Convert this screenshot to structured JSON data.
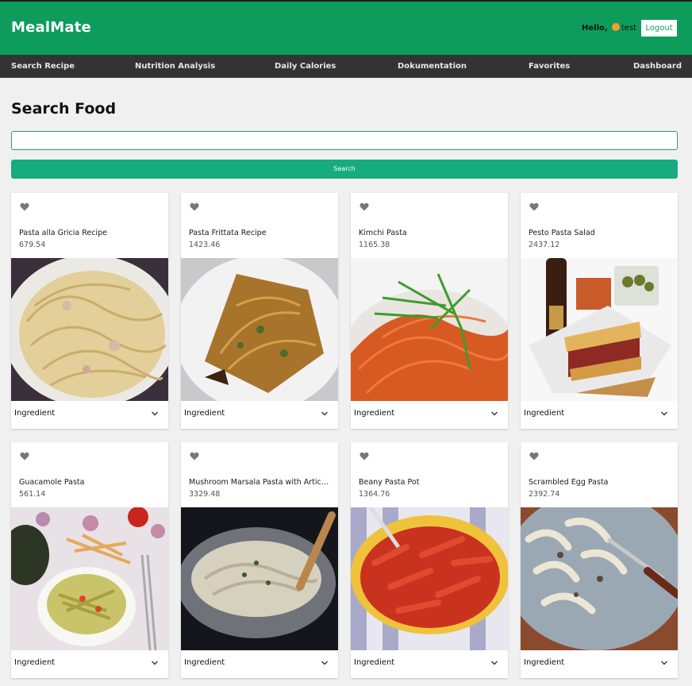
{
  "app": {
    "brand": "MealMate"
  },
  "header": {
    "greeting_prefix": "Hello,",
    "user": "test",
    "logout_label": "Logout"
  },
  "nav": {
    "items": [
      {
        "label": "Search Recipe"
      },
      {
        "label": "Nutrition Analysis"
      },
      {
        "label": "Daily Calories"
      },
      {
        "label": "Dokumentation"
      },
      {
        "label": "Favorites"
      },
      {
        "label": "Dashboard"
      }
    ]
  },
  "search": {
    "title": "Search Food",
    "value": "",
    "placeholder": "",
    "button_label": "Search"
  },
  "recipes": [
    {
      "title": "Pasta alla Gricia Recipe",
      "calories": "679.54",
      "expander_label": "Ingredient"
    },
    {
      "title": "Pasta Frittata Recipe",
      "calories": "1423.46",
      "expander_label": "Ingredient"
    },
    {
      "title": "Kimchi Pasta",
      "calories": "1165.38",
      "expander_label": "Ingredient"
    },
    {
      "title": "Pesto Pasta Salad",
      "calories": "2437.12",
      "expander_label": "Ingredient"
    },
    {
      "title": "Guacamole Pasta",
      "calories": "561.14",
      "expander_label": "Ingredient"
    },
    {
      "title": "Mushroom Marsala Pasta with Artichokes",
      "calories": "3329.48",
      "expander_label": "Ingredient"
    },
    {
      "title": "Beany Pasta Pot",
      "calories": "1364.76",
      "expander_label": "Ingredient"
    },
    {
      "title": "Scrambled Egg Pasta",
      "calories": "2392.74",
      "expander_label": "Ingredient"
    }
  ],
  "colors": {
    "header_green": "#0e9c5c",
    "nav_dark": "#333333",
    "search_button": "#17ab80",
    "page_background": "#f0f0f0",
    "heart_icon": "#777777"
  },
  "icons": {
    "favorite": "heart-icon",
    "expand": "chevron-down-icon"
  }
}
